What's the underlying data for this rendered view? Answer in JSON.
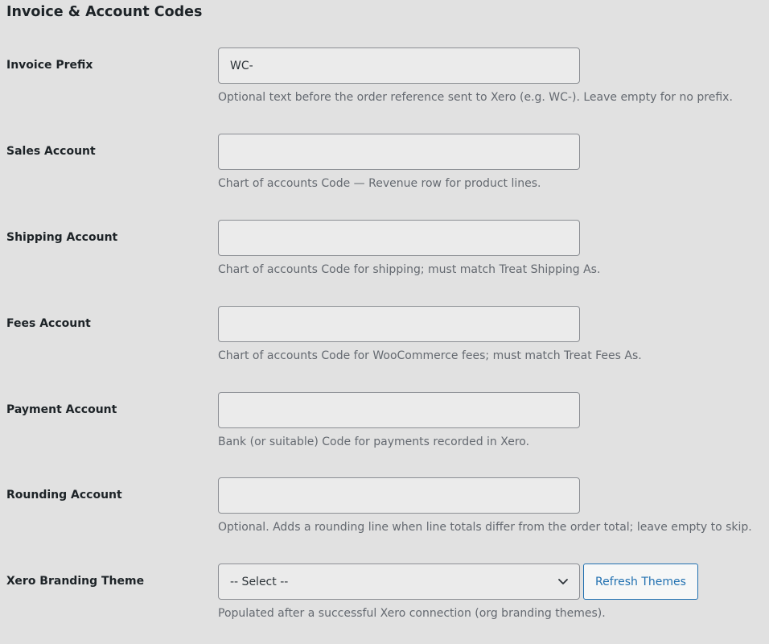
{
  "section": {
    "title": "Invoice & Account Codes"
  },
  "fields": {
    "invoice_prefix": {
      "label": "Invoice Prefix",
      "value": "WC-",
      "description": "Optional text before the order reference sent to Xero (e.g. WC-). Leave empty for no prefix."
    },
    "sales_account": {
      "label": "Sales Account",
      "value": "",
      "description": "Chart of accounts Code — Revenue row for product lines."
    },
    "shipping_account": {
      "label": "Shipping Account",
      "value": "",
      "description": "Chart of accounts Code for shipping; must match Treat Shipping As."
    },
    "fees_account": {
      "label": "Fees Account",
      "value": "",
      "description": "Chart of accounts Code for WooCommerce fees; must match Treat Fees As."
    },
    "payment_account": {
      "label": "Payment Account",
      "value": "",
      "description": "Bank (or suitable) Code for payments recorded in Xero."
    },
    "rounding_account": {
      "label": "Rounding Account",
      "value": "",
      "description": "Optional. Adds a rounding line when line totals differ from the order total; leave empty to skip."
    },
    "branding_theme": {
      "label": "Xero Branding Theme",
      "selected": "-- Select --",
      "button_label": "Refresh Themes",
      "description": "Populated after a successful Xero connection (org branding themes)."
    }
  },
  "icons": {
    "select_chevron": "chevron-down-icon"
  },
  "colors": {
    "background": "#e1e1e1",
    "input_background": "#ebebeb",
    "input_border": "#8c8f94",
    "button_accent": "#2271b1",
    "description_text": "#646970"
  }
}
